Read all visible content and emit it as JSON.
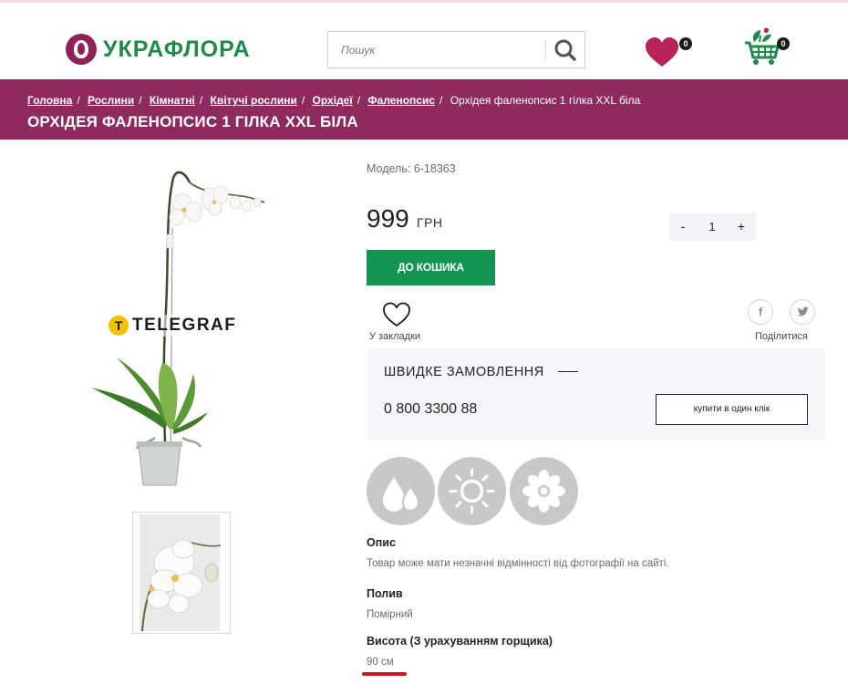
{
  "header": {
    "logo_text": "УКРАФЛОРА",
    "search_placeholder": "Пошук",
    "favorites_count": "0",
    "cart_count": "0"
  },
  "breadcrumbs": [
    {
      "label": "Головна"
    },
    {
      "label": "Рослини"
    },
    {
      "label": "Кімнатні"
    },
    {
      "label": "Квітучі рослини"
    },
    {
      "label": "Орхідеї"
    },
    {
      "label": "Фаленопсис"
    },
    {
      "label": "Орхідея фаленопсис 1 гілка XXL біла"
    }
  ],
  "page_title": "ОРХІДЕЯ ФАЛЕНОПСИС 1 ГІЛКА XXL БІЛА",
  "gallery": {
    "watermark_letter": "T",
    "watermark_text": "TELEGRAF"
  },
  "product": {
    "model": "Модель: 6-18363",
    "price": "999",
    "currency": "ГРН",
    "quantity": "1",
    "qty_minus": "-",
    "qty_plus": "+",
    "buy_label": "ДО КОШИКА",
    "bookmark_label": "У закладки",
    "share_label": "Поділитися",
    "social_fb": "f",
    "social_tw": "t"
  },
  "quick_order": {
    "title": "ШВИДКЕ ЗАМОВЛЕННЯ",
    "phone": "0 800 3300 88",
    "button_label": "купити в один клік"
  },
  "care_icons": [
    "water-drops-icon",
    "sun-icon",
    "flower-icon"
  ],
  "details": {
    "description_label": "Опис",
    "description_value": "Товар може мати незначні відмінності від фотографії на сайті.",
    "watering_label": "Полив",
    "watering_value": "Помірний",
    "height_label": "Висота (З урахуванням горщика)",
    "height_value": "90 см"
  },
  "colors": {
    "brand_purple": "#8e2a5e",
    "brand_green": "#1e8a4b",
    "buy_green": "#129453",
    "heart": "#b8245a",
    "highlight_red": "#d11227"
  }
}
